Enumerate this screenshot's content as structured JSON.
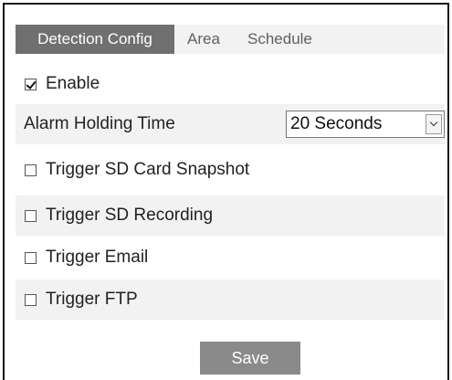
{
  "tabs": [
    {
      "label": "Detection Config",
      "active": true
    },
    {
      "label": "Area",
      "active": false
    },
    {
      "label": "Schedule",
      "active": false
    }
  ],
  "enable": {
    "label": "Enable",
    "checked": true
  },
  "alarm_holding_time": {
    "label": "Alarm Holding Time",
    "value": "20 Seconds"
  },
  "triggers": [
    {
      "label": "Trigger SD Card Snapshot",
      "checked": false
    },
    {
      "label": "Trigger SD Recording",
      "checked": false
    },
    {
      "label": "Trigger Email",
      "checked": false
    },
    {
      "label": "Trigger FTP",
      "checked": false
    }
  ],
  "save_label": "Save",
  "colors": {
    "active_tab": "#707070",
    "row_shade": "#f2f2f2",
    "save_button": "#8a8a8a"
  },
  "icons": {
    "enable_checkbox": "checkbox-checked-icon",
    "trigger_checkbox": "checkbox-empty-icon",
    "dropdown": "chevron-down-icon"
  }
}
